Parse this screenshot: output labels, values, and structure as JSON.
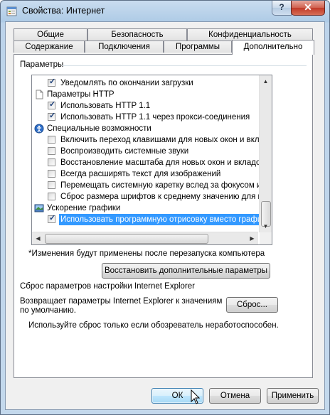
{
  "window": {
    "title": "Свойства: Интернет",
    "help": "?",
    "close": "✕"
  },
  "tabs_row1": [
    "Общие",
    "Безопасность",
    "Конфиденциальность"
  ],
  "tabs_row2": [
    "Содержание",
    "Подключения",
    "Программы",
    "Дополнительно"
  ],
  "settings": {
    "group_label": "Параметры",
    "items": [
      {
        "kind": "checkbox",
        "checked": true,
        "label": "Уведомлять по окончании загрузки"
      },
      {
        "kind": "category",
        "icon": "page-icon",
        "label": "Параметры HTTP"
      },
      {
        "kind": "checkbox",
        "checked": true,
        "label": "Использовать HTTP 1.1"
      },
      {
        "kind": "checkbox",
        "checked": true,
        "label": "Использовать HTTP 1.1 через прокси-соединения"
      },
      {
        "kind": "category",
        "icon": "accessibility-icon",
        "label": "Специальные возможности"
      },
      {
        "kind": "checkbox",
        "checked": false,
        "label": "Включить переход клавишами для новых окон и вкла,"
      },
      {
        "kind": "checkbox",
        "checked": false,
        "label": "Воспроизводить системные звуки"
      },
      {
        "kind": "checkbox",
        "checked": false,
        "label": "Восстановление масштаба для новых окон и вкладок"
      },
      {
        "kind": "checkbox",
        "checked": false,
        "label": "Всегда расширять текст для изображений"
      },
      {
        "kind": "checkbox",
        "checked": false,
        "label": "Перемещать системную каретку вслед за фокусом и в"
      },
      {
        "kind": "checkbox",
        "checked": false,
        "label": "Сброс размера шрифтов к среднему значению для нове"
      },
      {
        "kind": "category",
        "icon": "graphics-icon",
        "label": "Ускорение графики"
      },
      {
        "kind": "checkbox",
        "checked": true,
        "highlighted": true,
        "label": "Использовать программную отрисовку вместо графич"
      }
    ],
    "restart_note": "*Изменения будут применены после перезапуска компьютера",
    "restore_button": "Восстановить дополнительные параметры"
  },
  "reset": {
    "title": "Сброс параметров настройки Internet Explorer",
    "description_line1": "Возвращает параметры Internet Explorer к значениям",
    "description_line2": "по умолчанию.",
    "button": "Сброс...",
    "warning": "Используйте сброс только если обозреватель неработоспособен."
  },
  "footer": {
    "ok": "ОК",
    "cancel": "Отмена",
    "apply": "Применить"
  }
}
